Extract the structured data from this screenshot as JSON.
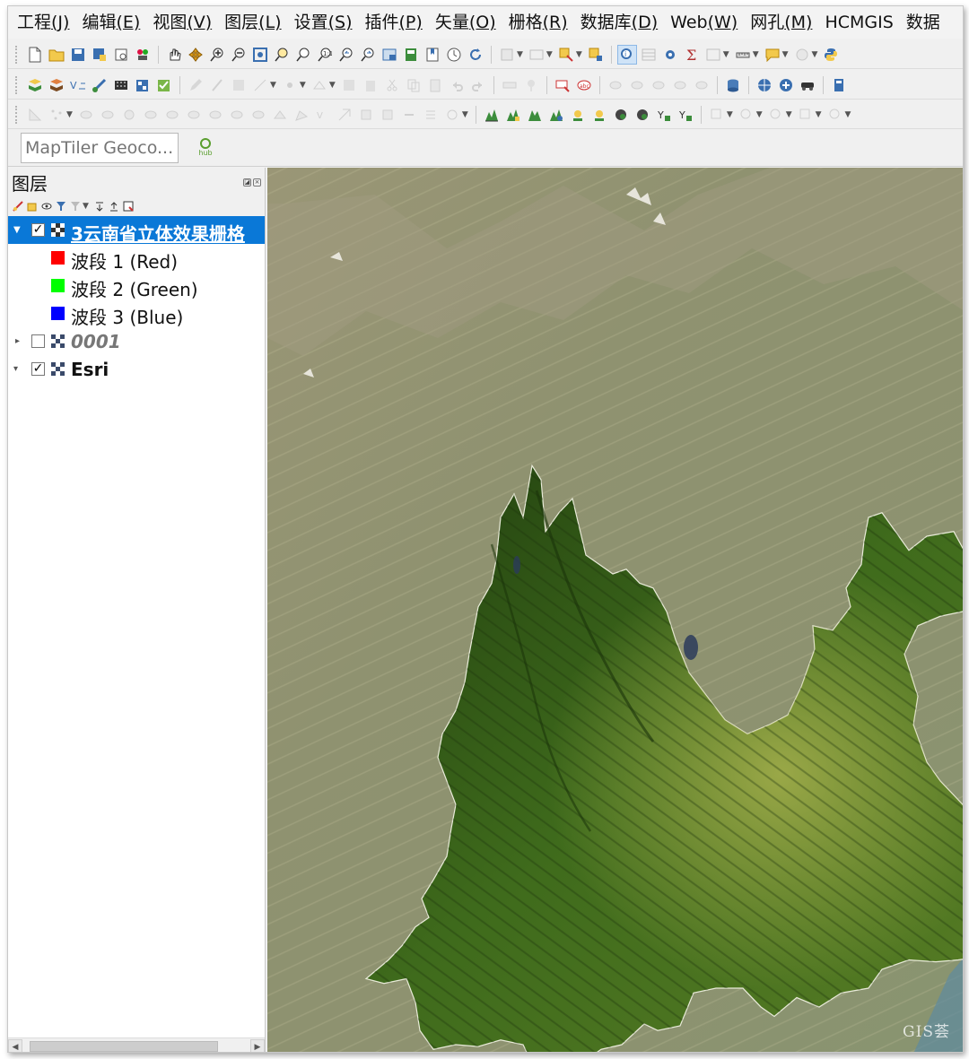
{
  "menubar": {
    "items": [
      {
        "label": "工程",
        "mnemonic": "(J)"
      },
      {
        "label": "编辑",
        "mnemonic": "(E)"
      },
      {
        "label": "视图",
        "mnemonic": "(V)"
      },
      {
        "label": "图层",
        "mnemonic": "(L)"
      },
      {
        "label": "设置",
        "mnemonic": "(S)"
      },
      {
        "label": "插件",
        "mnemonic": "(P)"
      },
      {
        "label": "矢量",
        "mnemonic": "(O)"
      },
      {
        "label": "栅格",
        "mnemonic": "(R)"
      },
      {
        "label": "数据库",
        "mnemonic": "(D)"
      },
      {
        "label": "Web",
        "mnemonic": "(W)"
      },
      {
        "label": "网孔",
        "mnemonic": "(M)"
      },
      {
        "label": "HCMGIS",
        "mnemonic": ""
      },
      {
        "label": "数据",
        "mnemonic": ""
      }
    ]
  },
  "locator_toolbar": {
    "geocoder_placeholder": "MapTiler Geoco..."
  },
  "layers_panel": {
    "title": "图层",
    "layers": [
      {
        "name": "3云南省立体效果栅格",
        "checked": true,
        "expanded": true,
        "selected": true,
        "bands": [
          {
            "label": "波段 1 (Red)",
            "color": "#ff0000"
          },
          {
            "label": "波段 2 (Green)",
            "color": "#00ff00"
          },
          {
            "label": "波段 3 (Blue)",
            "color": "#0000ff"
          }
        ]
      },
      {
        "name": "0001",
        "checked": false,
        "expanded": false,
        "selected": false
      },
      {
        "name": "Esri",
        "checked": true,
        "expanded": true,
        "selected": false
      }
    ]
  },
  "map": {
    "watermark": "GIS荟",
    "colors": {
      "basemap": "#90936e",
      "province_fill": "#3f6b1c",
      "province_dark": "#213f0f",
      "province_light": "#a9b24f",
      "selection_blue": "#0a78d7"
    }
  },
  "status": {
    "check_mark": "✓"
  }
}
